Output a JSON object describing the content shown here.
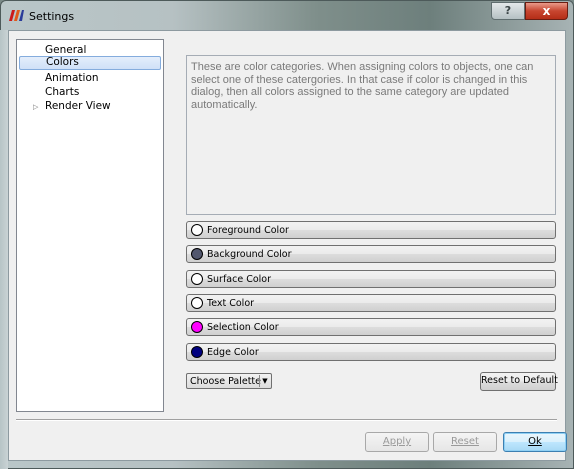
{
  "window": {
    "title": "Settings",
    "help_label": "?",
    "close_label": "x",
    "icon": "paraview-app-icon"
  },
  "sidebar": {
    "items": [
      {
        "label": "General",
        "selected": false
      },
      {
        "label": "Colors",
        "selected": true
      },
      {
        "label": "Animation",
        "selected": false
      },
      {
        "label": "Charts",
        "selected": false
      },
      {
        "label": "Render View",
        "selected": false,
        "expandable": true
      }
    ]
  },
  "colors_page": {
    "description": "These are color categories. When assigning colors to objects, one can select one of these catergories. In that case if color is changed in this dialog, then all colors assigned to the same category are updated automatically.",
    "categories": [
      {
        "label": "Foreground Color",
        "color": "#ffffff"
      },
      {
        "label": "Background Color",
        "color": "#52576e"
      },
      {
        "label": "Surface Color",
        "color": "#ffffff"
      },
      {
        "label": "Text Color",
        "color": "#ffffff"
      },
      {
        "label": "Selection Color",
        "color": "#ff00ff"
      },
      {
        "label": "Edge Color",
        "color": "#000080"
      }
    ],
    "palette_label": "Choose Palette",
    "reset_label": "Reset to Default"
  },
  "footer": {
    "apply_label": "Apply",
    "reset_label": "Reset",
    "ok_label": "Ok"
  }
}
